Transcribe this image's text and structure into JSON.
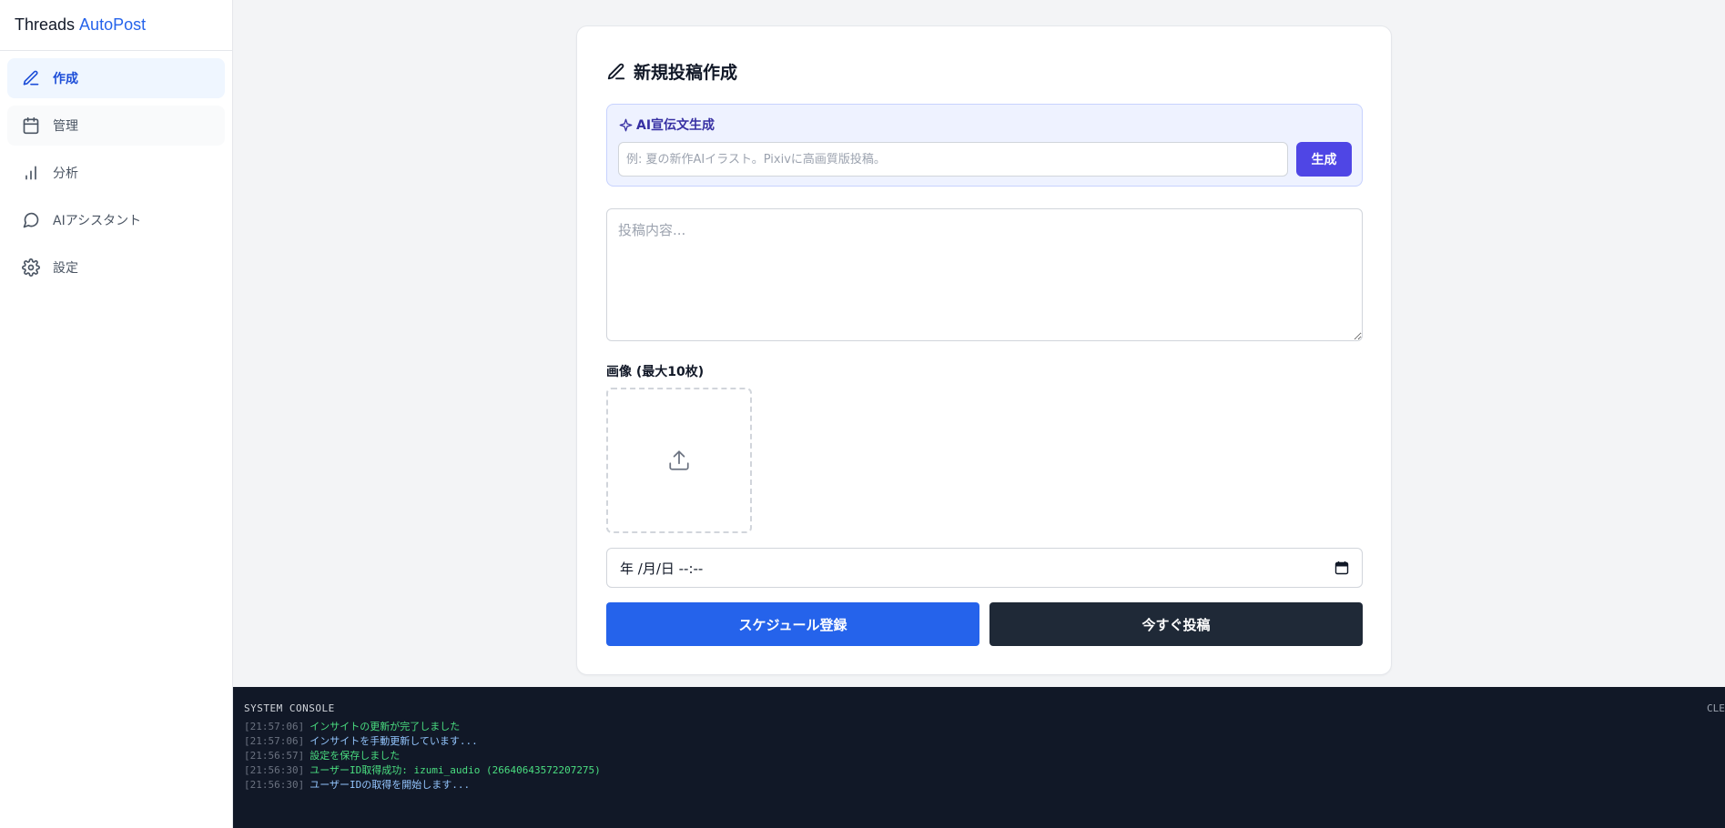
{
  "brand": {
    "part1": "Threads",
    "part2": "AutoPost"
  },
  "sidebar": {
    "items": [
      {
        "label": "作成",
        "icon": "pencil-icon",
        "active": true
      },
      {
        "label": "管理",
        "icon": "calendar-icon"
      },
      {
        "label": "分析",
        "icon": "bar-chart-icon"
      },
      {
        "label": "AIアシスタント",
        "icon": "message-circle-icon"
      },
      {
        "label": "設定",
        "icon": "gear-icon"
      }
    ]
  },
  "form": {
    "title": "新規投稿作成",
    "ai": {
      "label": "AI宣伝文生成",
      "placeholder": "例: 夏の新作AIイラスト。Pixivに高画質版投稿。",
      "button": "生成"
    },
    "content_placeholder": "投稿内容...",
    "images_label": "画像 (最大10枚)",
    "datetime_value": "年 /月/日  --:--",
    "schedule_button": "スケジュール登録",
    "post_now_button": "今すぐ投稿"
  },
  "console": {
    "title": "SYSTEM CONSOLE",
    "clear_label": "CLEAR",
    "logs": [
      {
        "time": "[21:57:06]",
        "message": "インサイトの更新が完了しました",
        "color": "green"
      },
      {
        "time": "[21:57:06]",
        "message": "インサイトを手動更新しています...",
        "color": "blue"
      },
      {
        "time": "[21:56:57]",
        "message": "設定を保存しました",
        "color": "green"
      },
      {
        "time": "[21:56:30]",
        "message": "ユーザーID取得成功: izumi_audio (26640643572207275)",
        "color": "green"
      },
      {
        "time": "[21:56:30]",
        "message": "ユーザーIDの取得を開始します...",
        "color": "blue"
      }
    ]
  },
  "colors": {
    "primary": "#2563eb",
    "ai_button": "#4f46e5",
    "dark_button": "#1f2937",
    "console_bg": "#111827"
  }
}
